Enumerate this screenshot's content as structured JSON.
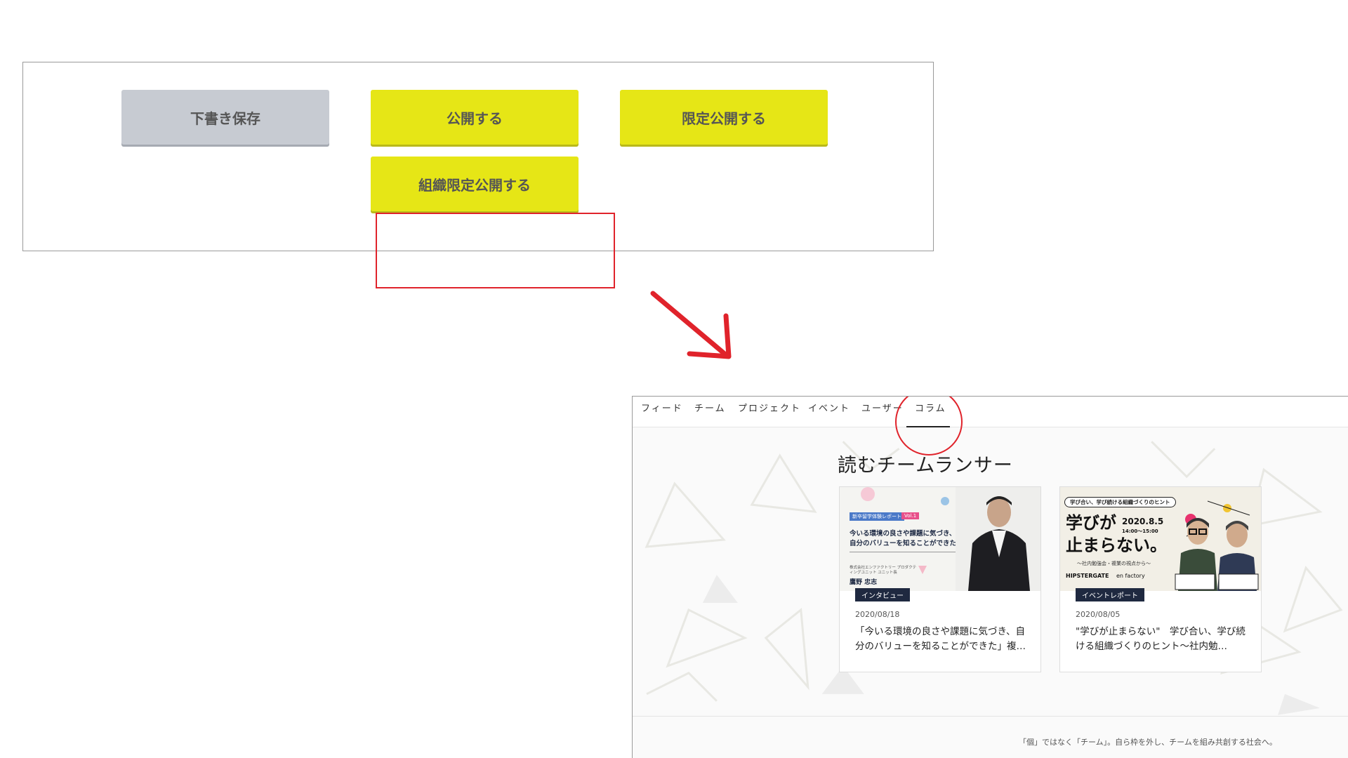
{
  "buttons": {
    "draft": "下書き保存",
    "publish": "公開する",
    "limited": "限定公開する",
    "org_limited": "組織限定公開する"
  },
  "nav": {
    "items": [
      "フィード",
      "チーム",
      "プロジェクト",
      "イベント",
      "ユーザー",
      "コラム"
    ],
    "active": "コラム"
  },
  "section_title": "読むチームランサー",
  "cards": [
    {
      "tag": "インタビュー",
      "date": "2020/08/18",
      "title": "「今いる環境の良さや課題に気づき、自分のバリューを知ることができた」複…",
      "thumb": {
        "badge": "新卒留学体験レポート",
        "badge2": "Vol.1",
        "headline": "今いる環境の良さや課題に気づき、自分のバリューを知ることができた",
        "sub": "株式会社エンファクトリー プロダクティングユニット ユニット長",
        "name": "鷹野 忠志"
      }
    },
    {
      "tag": "イベントレポート",
      "date": "2020/08/05",
      "title": "\"学びが止まらない\"　学び合い、学び続ける組織づくりのヒント〜社内勉…",
      "thumb": {
        "pill": "学び合い、学び続ける組織づくりのヒント",
        "big1": "学びが",
        "big2": "止まらない。",
        "date": "2020.8.5",
        "time": "14:00〜15:00",
        "sub": "〜社内勉強会・複業の視点から〜",
        "logo": "HIPSTERGATE",
        "logo2": "en factory"
      }
    }
  ],
  "footer": "「個」ではなく「チーム」。自ら枠を外し、チームを組み共創する社会へ。",
  "colors": {
    "accent_yellow": "#e6e616",
    "draft_gray": "#c7cbd2",
    "highlight_red": "#e0232b",
    "tag_navy": "#1f2940"
  }
}
